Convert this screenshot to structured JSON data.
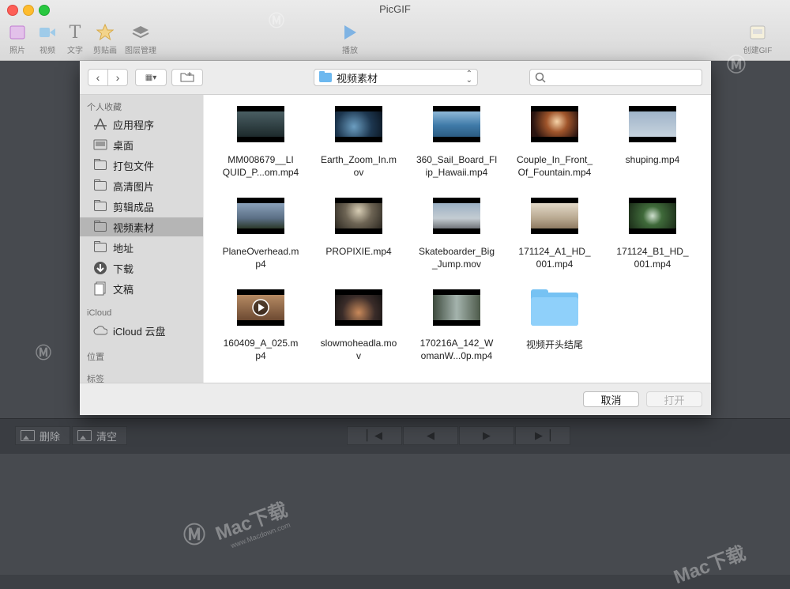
{
  "window": {
    "title": "PicGIF"
  },
  "toolbar": {
    "items": [
      {
        "label": "照片",
        "icon": "photo-icon"
      },
      {
        "label": "视频",
        "icon": "video-icon"
      },
      {
        "label": "文字",
        "icon": "text-icon"
      },
      {
        "label": "剪贴画",
        "icon": "star-icon"
      },
      {
        "label": "图层管理",
        "icon": "layers-icon"
      },
      {
        "label": "播放",
        "icon": "play-icon"
      },
      {
        "label": "创建GIF",
        "icon": "create-gif-icon"
      }
    ]
  },
  "controls": {
    "delete_label": "删除",
    "clear_label": "清空",
    "playback": [
      "first-frame-icon",
      "previous-frame-icon",
      "next-frame-icon",
      "last-frame-icon"
    ]
  },
  "dialog": {
    "location": "视频素材",
    "search_placeholder": "",
    "sidebar": {
      "favorites_header": "个人收藏",
      "favorites": [
        {
          "label": "应用程序",
          "icon": "applications-icon"
        },
        {
          "label": "桌面",
          "icon": "desktop-icon"
        },
        {
          "label": "打包文件",
          "icon": "folder-icon"
        },
        {
          "label": "高清图片",
          "icon": "folder-icon"
        },
        {
          "label": "剪辑成品",
          "icon": "folder-icon"
        },
        {
          "label": "视频素材",
          "icon": "folder-icon",
          "selected": true
        },
        {
          "label": "地址",
          "icon": "folder-icon"
        },
        {
          "label": "下载",
          "icon": "downloads-icon"
        },
        {
          "label": "文稿",
          "icon": "documents-icon"
        }
      ],
      "icloud_header": "iCloud",
      "icloud_items": [
        {
          "label": "iCloud 云盘",
          "icon": "cloud-icon"
        }
      ],
      "locations_header": "位置",
      "tags_header": "标签"
    },
    "files": [
      {
        "line1": "MM008679__LI",
        "line2": "QUID_P...om.mp4"
      },
      {
        "line1": "Earth_Zoom_In.m",
        "line2": "ov"
      },
      {
        "line1": "360_Sail_Board_Fl",
        "line2": "ip_Hawaii.mp4"
      },
      {
        "line1": "Couple_In_Front_",
        "line2": "Of_Fountain.mp4"
      },
      {
        "line1": "shuping.mp4",
        "line2": ""
      },
      {
        "line1": "PlaneOverhead.m",
        "line2": "p4"
      },
      {
        "line1": "PROPIXIE.mp4",
        "line2": ""
      },
      {
        "line1": "Skateboarder_Big",
        "line2": "_Jump.mov"
      },
      {
        "line1": "171124_A1_HD_",
        "line2": "001.mp4"
      },
      {
        "line1": "171124_B1_HD_",
        "line2": "001.mp4"
      },
      {
        "line1": "160409_A_025.m",
        "line2": "p4"
      },
      {
        "line1": "slowmoheadla.mo",
        "line2": "v"
      },
      {
        "line1": "170216A_142_W",
        "line2": "omanW...0p.mp4"
      },
      {
        "line1": "视频开头结尾",
        "line2": ""
      }
    ],
    "cancel_label": "取消",
    "open_label": "打开"
  },
  "watermark": {
    "brand": "Mac下载",
    "site": "www.Macdown.com"
  }
}
